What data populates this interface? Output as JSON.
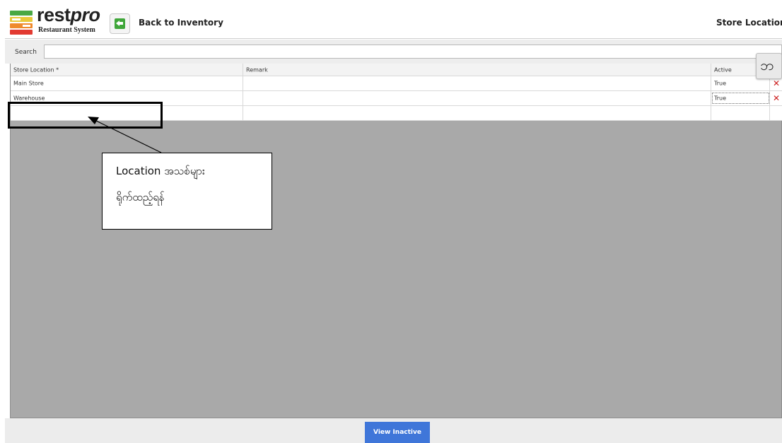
{
  "header": {
    "logo_word_main": "rest",
    "logo_word_italic": "pro",
    "logo_subtitle": "Restaurant System",
    "back_label": "Back to Inventory",
    "page_title": "Store Locations"
  },
  "search": {
    "label": "Search",
    "value": "",
    "placeholder": ""
  },
  "grid": {
    "columns": [
      "Store Location *",
      "Remark",
      "Active"
    ],
    "rows": [
      {
        "location": "Main Store",
        "remark": "",
        "active": "True"
      },
      {
        "location": "Warehouse",
        "remark": "",
        "active": "True"
      }
    ]
  },
  "language_button": {
    "glyph": "ဘ"
  },
  "annotation": {
    "line1": "Location အသစ်များ",
    "line2": "ရိုက်ထည့်ရန်"
  },
  "footer": {
    "view_inactive_label": "View Inactive"
  },
  "colors": {
    "accent": "#3f76d9",
    "delete": "#cc1f1f",
    "grid_background": "#a9a9a9",
    "back_icon": "#3fa63a"
  },
  "icons": [
    "back-arrow-icon",
    "delete-icon",
    "language-icon"
  ]
}
